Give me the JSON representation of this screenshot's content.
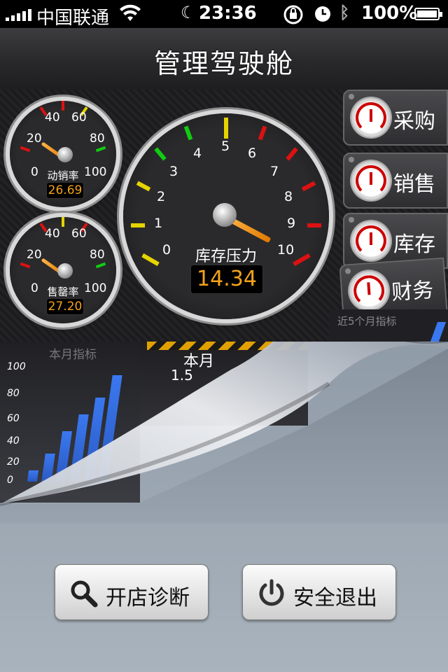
{
  "status_bar": {
    "carrier": "中国联通",
    "time": "23:36",
    "battery": "100%",
    "icons": [
      "signal-icon",
      "wifi-icon",
      "moon-icon",
      "rotation-lock-icon",
      "alarm-icon",
      "bluetooth-icon",
      "battery-icon"
    ]
  },
  "navbar": {
    "title": "管理驾驶舱"
  },
  "gauges": {
    "sales_rate": {
      "label": "动销率",
      "value": "26.69",
      "ticks": [
        "0",
        "20",
        "40",
        "60",
        "80",
        "100"
      ]
    },
    "sellout_rate": {
      "label": "售罄率",
      "value": "27.20",
      "ticks": [
        "0",
        "20",
        "40",
        "60",
        "80",
        "100"
      ]
    },
    "inventory_pressure": {
      "label": "库存压力",
      "value": "14.34",
      "ticks": [
        "0",
        "1",
        "2",
        "3",
        "4",
        "5",
        "6",
        "7",
        "8",
        "9",
        "10"
      ]
    }
  },
  "side_tabs": [
    {
      "label": "采购"
    },
    {
      "label": "销售"
    },
    {
      "label": "库存"
    },
    {
      "label": "财务"
    }
  ],
  "page_under": {
    "chart_title": "本月指标",
    "chart_yticks": [
      "100",
      "80",
      "60",
      "40",
      "20",
      "0"
    ],
    "chart_values": [
      10,
      25,
      45,
      60,
      75,
      95
    ],
    "middle_title": "本月",
    "middle_value": "1.5",
    "right_title": "近5个月指标"
  },
  "buttons": {
    "diagnose": "开店诊断",
    "logout": "安全退出"
  },
  "colors": {
    "readout": "#f3a21a",
    "accent_blue": "#3a78f0",
    "nav": "#2a2a2c"
  }
}
